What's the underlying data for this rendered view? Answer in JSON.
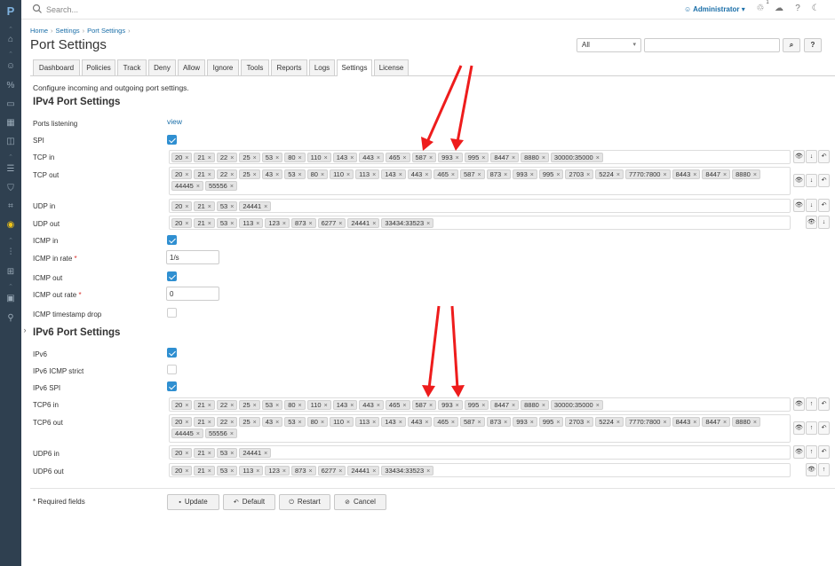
{
  "topbar": {
    "search_placeholder": "Search...",
    "user": "Administrator",
    "notification_count": "1"
  },
  "breadcrumb": [
    "Home",
    "Settings",
    "Port Settings"
  ],
  "page_title": "Port Settings",
  "filter": {
    "selected": "All",
    "search_button": "⌕",
    "help_button": "?"
  },
  "tabs": [
    "Dashboard",
    "Policies",
    "Track",
    "Deny",
    "Allow",
    "Ignore",
    "Tools",
    "Reports",
    "Logs",
    "Settings",
    "License"
  ],
  "active_tab": "Settings",
  "description": "Configure incoming and outgoing port settings.",
  "ipv4": {
    "title": "IPv4 Port Settings",
    "ports_listening": {
      "label": "Ports listening",
      "link": "view"
    },
    "spi": {
      "label": "SPI",
      "checked": true
    },
    "tcp_in": {
      "label": "TCP in",
      "ports": [
        "20",
        "21",
        "22",
        "25",
        "53",
        "80",
        "110",
        "143",
        "443",
        "465",
        "587",
        "993",
        "995",
        "8447",
        "8880",
        "30000:35000"
      ]
    },
    "tcp_out": {
      "label": "TCP out",
      "ports": [
        "20",
        "21",
        "22",
        "25",
        "43",
        "53",
        "80",
        "110",
        "113",
        "143",
        "443",
        "465",
        "587",
        "873",
        "993",
        "995",
        "2703",
        "5224",
        "7770:7800",
        "8443",
        "8447",
        "8880",
        "44445",
        "55556"
      ]
    },
    "udp_in": {
      "label": "UDP in",
      "ports": [
        "20",
        "21",
        "53",
        "24441"
      ]
    },
    "udp_out": {
      "label": "UDP out",
      "ports": [
        "20",
        "21",
        "53",
        "113",
        "123",
        "873",
        "6277",
        "24441",
        "33434:33523"
      ]
    },
    "icmp_in": {
      "label": "ICMP in",
      "checked": true
    },
    "icmp_in_rate": {
      "label": "ICMP in rate",
      "value": "1/s"
    },
    "icmp_out": {
      "label": "ICMP out",
      "checked": true
    },
    "icmp_out_rate": {
      "label": "ICMP out rate",
      "value": "0"
    },
    "icmp_timestamp_drop": {
      "label": "ICMP timestamp drop",
      "checked": false
    }
  },
  "ipv6": {
    "title": "IPv6 Port Settings",
    "ipv6": {
      "label": "IPv6",
      "checked": true
    },
    "ipv6_icmp_strict": {
      "label": "IPv6 ICMP strict",
      "checked": false
    },
    "ipv6_spi": {
      "label": "IPv6 SPI",
      "checked": true
    },
    "tcp6_in": {
      "label": "TCP6 in",
      "ports": [
        "20",
        "21",
        "22",
        "25",
        "53",
        "80",
        "110",
        "143",
        "443",
        "465",
        "587",
        "993",
        "995",
        "8447",
        "8880",
        "30000:35000"
      ]
    },
    "tcp6_out": {
      "label": "TCP6 out",
      "ports": [
        "20",
        "21",
        "22",
        "25",
        "43",
        "53",
        "80",
        "110",
        "113",
        "143",
        "443",
        "465",
        "587",
        "873",
        "993",
        "995",
        "2703",
        "5224",
        "7770:7800",
        "8443",
        "8447",
        "8880",
        "44445",
        "55556"
      ]
    },
    "udp6_in": {
      "label": "UDP6 in",
      "ports": [
        "20",
        "21",
        "53",
        "24441"
      ]
    },
    "udp6_out": {
      "label": "UDP6 out",
      "ports": [
        "20",
        "21",
        "53",
        "113",
        "123",
        "873",
        "6277",
        "24441",
        "33434:33523"
      ]
    }
  },
  "required_note": "* Required fields",
  "actions": {
    "update": "Update",
    "default": "Default",
    "restart": "Restart",
    "cancel": "Cancel"
  },
  "annotation_color": "#ee1c1c",
  "accent_color": "#2f8fd1"
}
